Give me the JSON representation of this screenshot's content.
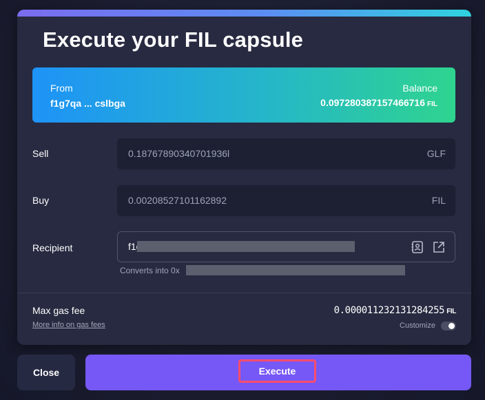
{
  "modal": {
    "title": "Execute your FIL capsule"
  },
  "from_card": {
    "from_label": "From",
    "from_address": "f1g7qa ... cslbga",
    "balance_label": "Balance",
    "balance_value": "0.097280387157466716",
    "balance_unit": "FIL"
  },
  "sell": {
    "label": "Sell",
    "value": "0.18767890340701936l",
    "unit": "GLF"
  },
  "buy": {
    "label": "Buy",
    "value": "0.00208527101162892",
    "unit": "FIL"
  },
  "recipient": {
    "label": "Recipient",
    "value_prefix": "f1g",
    "converts_prefix": "Converts into 0x"
  },
  "gas": {
    "label": "Max gas fee",
    "link": "More info on gas fees",
    "value": "0.000011232131284255",
    "unit": "FIL",
    "customize_label": "Customize",
    "customize_enabled": false
  },
  "actions": {
    "close_label": "Close",
    "execute_label": "Execute"
  },
  "colors": {
    "accent": "#7558f5",
    "highlight": "#ff4d6d"
  }
}
